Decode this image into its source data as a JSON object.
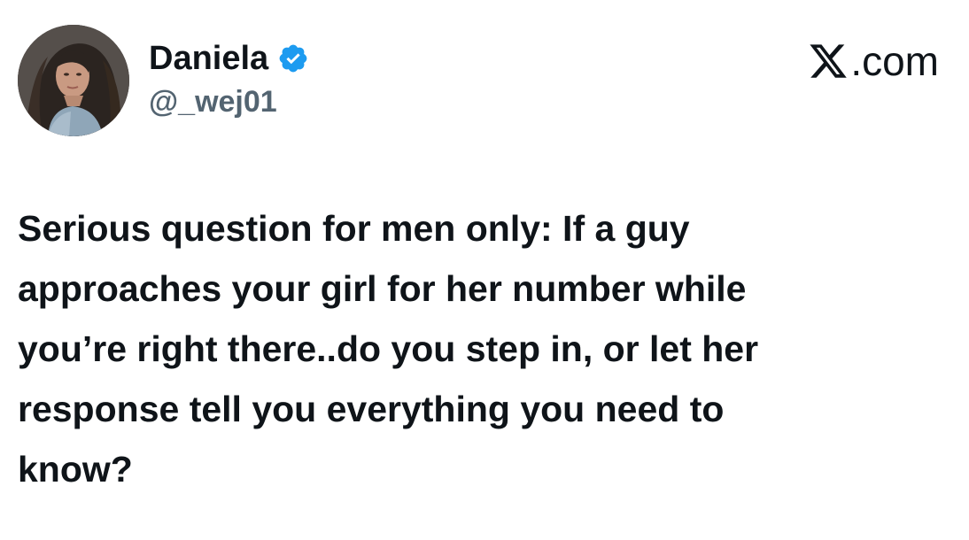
{
  "user": {
    "display_name": "Daniela",
    "handle": "@_wej01",
    "verified": true,
    "verified_badge_color": "#1d9bf0",
    "avatar_icon": "profile-photo"
  },
  "brand": {
    "icon": "x-logo-icon",
    "text": ".com"
  },
  "tweet": {
    "text": "Serious question for men only: If a guy\napproaches your girl for her number while\nyou’re right there..do you step in, or let her\nresponse tell you everything you need to\nknow?"
  },
  "colors": {
    "text_primary": "#0f1419",
    "text_secondary": "#536471",
    "background": "#ffffff"
  }
}
